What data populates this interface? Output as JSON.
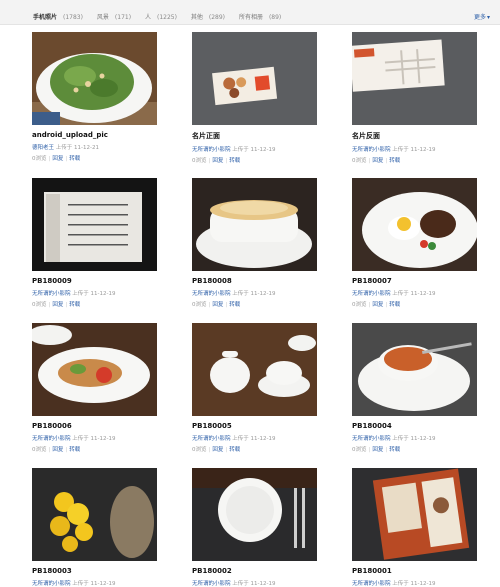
{
  "header": {
    "filters": [
      {
        "label": "手机照片",
        "count": "(1783)",
        "active": true
      },
      {
        "label": "风景",
        "count": "(171)"
      },
      {
        "label": "人",
        "count": "(1225)"
      },
      {
        "label": "其他",
        "count": "(289)"
      },
      {
        "label": "所有相册",
        "count": "(89)"
      }
    ],
    "more_label": "更多"
  },
  "photos": [
    {
      "title": "android_upload_pic",
      "uploader": "德阳老王",
      "action": "上传于",
      "date": "11-12-21",
      "views": "0浏览",
      "actions": [
        "回复",
        "转载"
      ]
    },
    {
      "title": "名片正面",
      "uploader": "无所谓的小影院",
      "action": "上传于",
      "date": "11-12-19",
      "views": "0浏览",
      "actions": [
        "回复",
        "转载"
      ]
    },
    {
      "title": "名片反面",
      "uploader": "无所谓的小影院",
      "action": "上传于",
      "date": "11-12-19",
      "views": "0浏览",
      "actions": [
        "回复",
        "转载"
      ]
    },
    {
      "title": "PB180009",
      "uploader": "无所谓的小影院",
      "action": "上传于",
      "date": "11-12-19",
      "views": "0浏览",
      "actions": [
        "回复",
        "转载"
      ]
    },
    {
      "title": "PB180008",
      "uploader": "无所谓的小影院",
      "action": "上传于",
      "date": "11-12-19",
      "views": "0浏览",
      "actions": [
        "回复",
        "转载"
      ]
    },
    {
      "title": "PB180007",
      "uploader": "无所谓的小影院",
      "action": "上传于",
      "date": "11-12-19",
      "views": "0浏览",
      "actions": [
        "回复",
        "转载"
      ]
    },
    {
      "title": "PB180006",
      "uploader": "无所谓的小影院",
      "action": "上传于",
      "date": "11-12-19",
      "views": "0浏览",
      "actions": [
        "回复",
        "转载"
      ]
    },
    {
      "title": "PB180005",
      "uploader": "无所谓的小影院",
      "action": "上传于",
      "date": "11-12-19",
      "views": "0浏览",
      "actions": [
        "回复",
        "转载"
      ]
    },
    {
      "title": "PB180004",
      "uploader": "无所谓的小影院",
      "action": "上传于",
      "date": "11-12-19",
      "views": "0浏览",
      "actions": [
        "回复",
        "转载"
      ]
    },
    {
      "title": "PB180003",
      "uploader": "无所谓的小影院",
      "action": "上传于",
      "date": "11-12-19",
      "views": "0浏览",
      "actions": [
        "回复",
        "转载"
      ]
    },
    {
      "title": "PB180002",
      "uploader": "无所谓的小影院",
      "action": "上传于",
      "date": "11-12-19",
      "views": "0浏览",
      "actions": [
        "回复",
        "转载"
      ]
    },
    {
      "title": "PB180001",
      "uploader": "无所谓的小影院",
      "action": "上传于",
      "date": "11-12-19",
      "views": "0浏览",
      "actions": [
        "回复",
        "转载"
      ]
    }
  ],
  "colors": {
    "link": "#2d5fa8",
    "muted": "#9a9a9a"
  }
}
